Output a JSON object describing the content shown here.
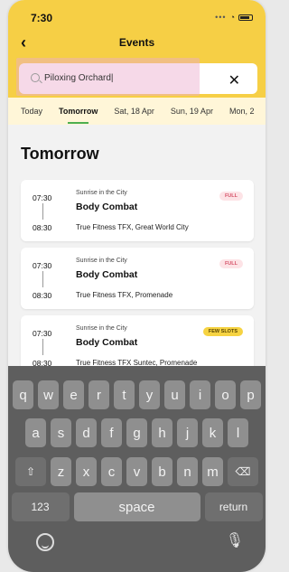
{
  "status": {
    "time": "7:30",
    "signal_icon": "signal-dots-icon",
    "battery_icon": "battery-icon"
  },
  "header": {
    "title": "Events",
    "back_icon": "‹",
    "search_value": "Piloxing Orchard|",
    "clear_icon": "✕"
  },
  "tabs": [
    {
      "label": "Today",
      "active": false
    },
    {
      "label": "Tomorrow",
      "active": true
    },
    {
      "label": "Sat, 18 Apr",
      "active": false
    },
    {
      "label": "Sun, 19 Apr",
      "active": false
    },
    {
      "label": "Mon, 2",
      "active": false
    }
  ],
  "section": {
    "title": "Tomorrow"
  },
  "events": [
    {
      "start": "07:30",
      "end": "08:30",
      "series": "Sunrise in the City",
      "name": "Body Combat",
      "venue": "True Fitness TFX, Great World City",
      "badge": "FULL",
      "badge_type": "full"
    },
    {
      "start": "07:30",
      "end": "08:30",
      "series": "Sunrise in the City",
      "name": "Body Combat",
      "venue": "True Fitness TFX, Promenade",
      "badge": "FULL",
      "badge_type": "full"
    },
    {
      "start": "07:30",
      "end": "08:30",
      "series": "Sunrise in the City",
      "name": "Body Combat",
      "venue": "True Fitness TFX Suntec, Promenade",
      "badge": "FEW SLOTS",
      "badge_type": "few"
    }
  ],
  "keyboard": {
    "row1": [
      "q",
      "w",
      "e",
      "r",
      "t",
      "y",
      "u",
      "i",
      "o",
      "p"
    ],
    "row2": [
      "a",
      "s",
      "d",
      "f",
      "g",
      "h",
      "j",
      "k",
      "l"
    ],
    "row3": [
      "z",
      "x",
      "c",
      "v",
      "b",
      "n",
      "m"
    ],
    "shift": "⇧",
    "delete": "⌫",
    "numbers": "123",
    "space": "space",
    "return": "return",
    "emoji_icon": "emoji-icon",
    "mic_icon": "🎙"
  },
  "colors": {
    "header_bg": "#f6cf45",
    "tabs_bg": "#fff6d8",
    "active_tab_underline": "#4caf50",
    "full_badge": "#fde3e6",
    "few_badge": "#f6d342",
    "keyboard_bg": "#5e5e5e"
  }
}
